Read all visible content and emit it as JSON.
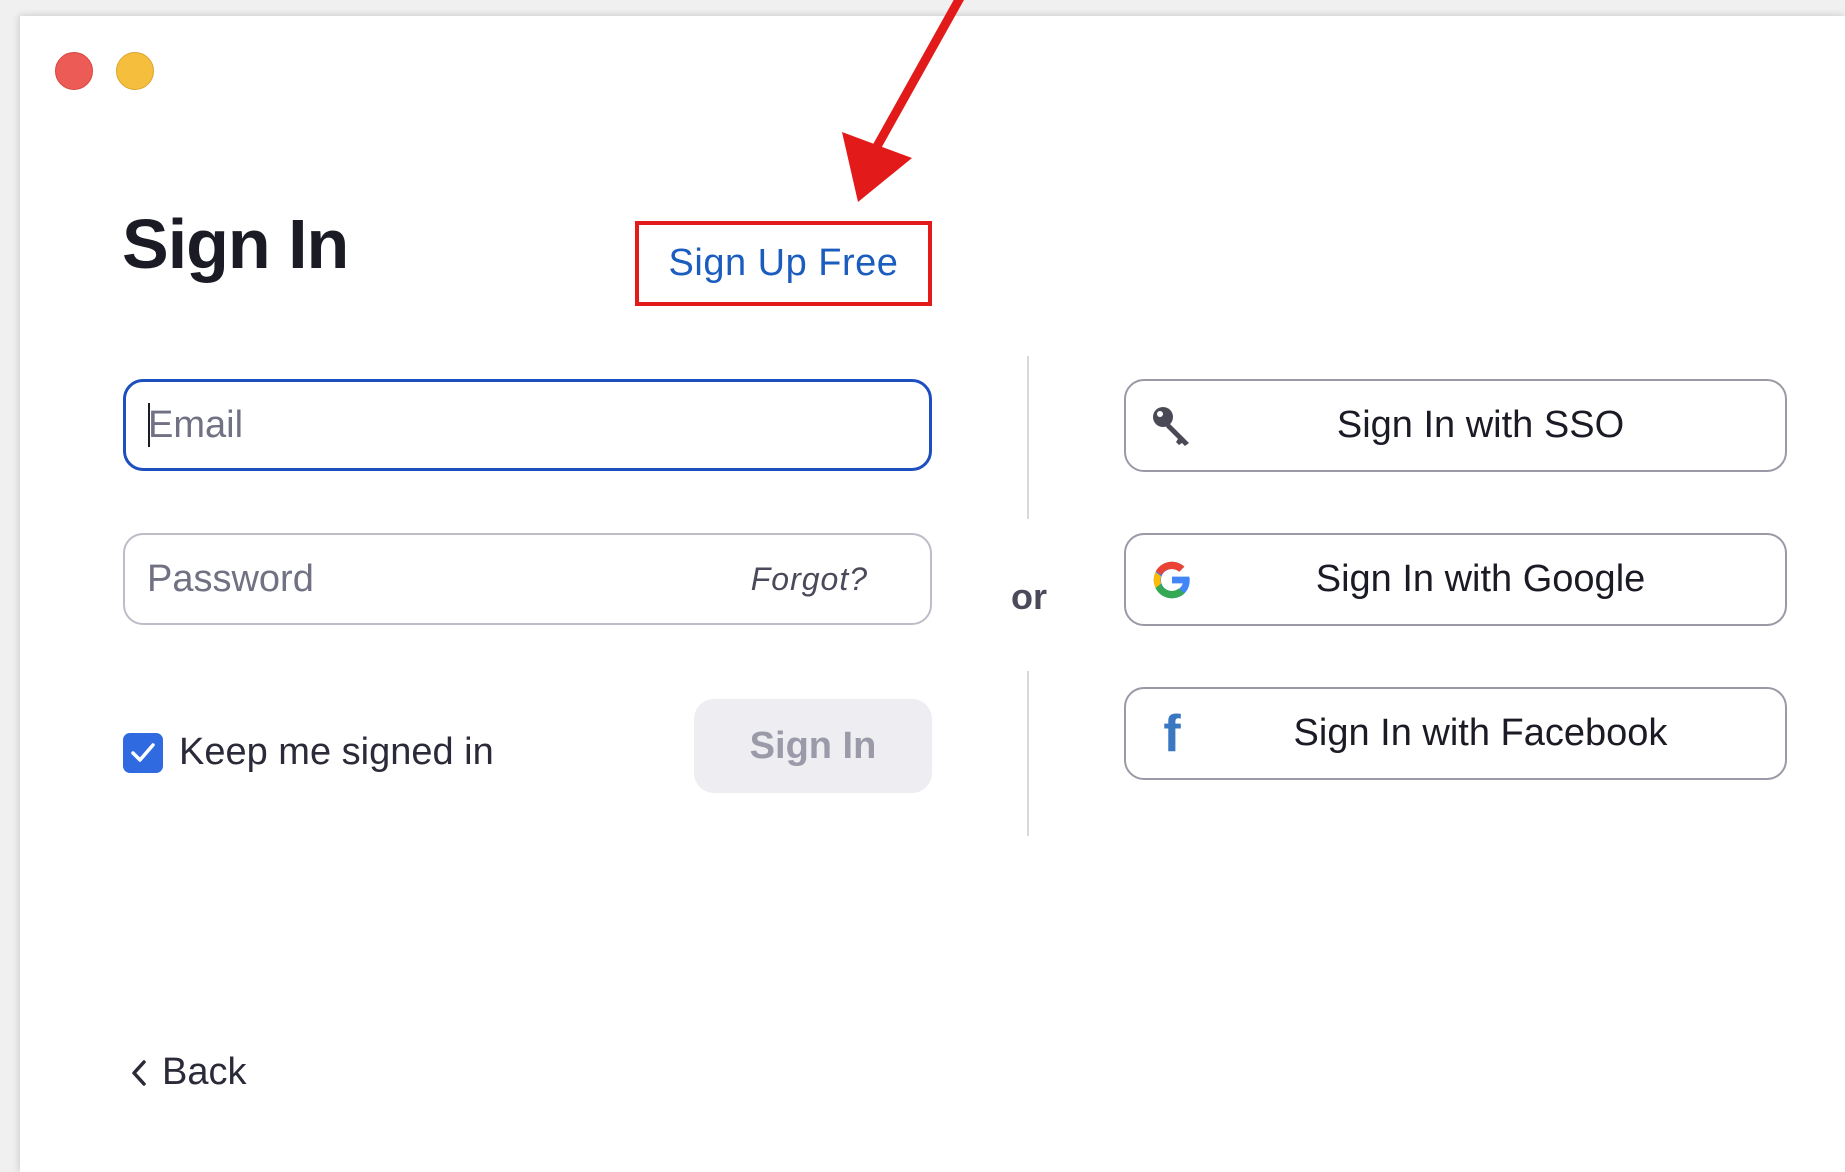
{
  "window": {
    "controls": [
      "close",
      "minimize"
    ]
  },
  "header": {
    "title": "Sign In",
    "signup_link": "Sign Up Free"
  },
  "form": {
    "email": {
      "placeholder": "Email",
      "value": ""
    },
    "password": {
      "placeholder": "Password",
      "value": ""
    },
    "forgot_label": "Forgot?",
    "keep_signed_in": {
      "label": "Keep me signed in",
      "checked": true
    },
    "signin_button": "Sign In"
  },
  "separator": {
    "label": "or"
  },
  "sso": [
    {
      "label": "Sign In with SSO",
      "icon": "key-icon"
    },
    {
      "label": "Sign In with Google",
      "icon": "google-icon"
    },
    {
      "label": "Sign In with Facebook",
      "icon": "facebook-icon"
    }
  ],
  "footer": {
    "back_label": "Back"
  },
  "colors": {
    "accent": "#1a5dbf",
    "focus_border": "#1d4fbf",
    "checkbox": "#2f6ae0",
    "annotation": "#e21a1a",
    "facebook": "#3b78c2"
  }
}
